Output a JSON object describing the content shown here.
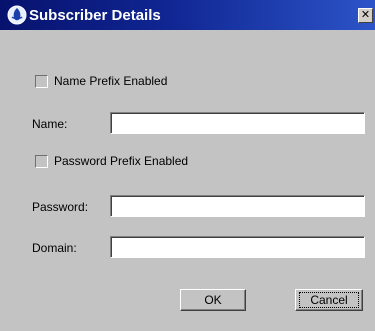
{
  "dialog": {
    "title": "Subscriber Details",
    "icon": "globe-hand-icon",
    "close_glyph": "✕"
  },
  "form": {
    "name_prefix_label": "Name Prefix Enabled",
    "name_prefix_checked": false,
    "name_label": "Name:",
    "name_value": "",
    "password_prefix_label": "Password Prefix Enabled",
    "password_prefix_checked": false,
    "password_label": "Password:",
    "password_value": "",
    "domain_label": "Domain:",
    "domain_value": ""
  },
  "buttons": {
    "ok_label": "OK",
    "cancel_label": "Cancel"
  },
  "colors": {
    "titlebar_start": "#07126e",
    "titlebar_end": "#2c54c8",
    "dialog_background": "#c3c3c3"
  }
}
